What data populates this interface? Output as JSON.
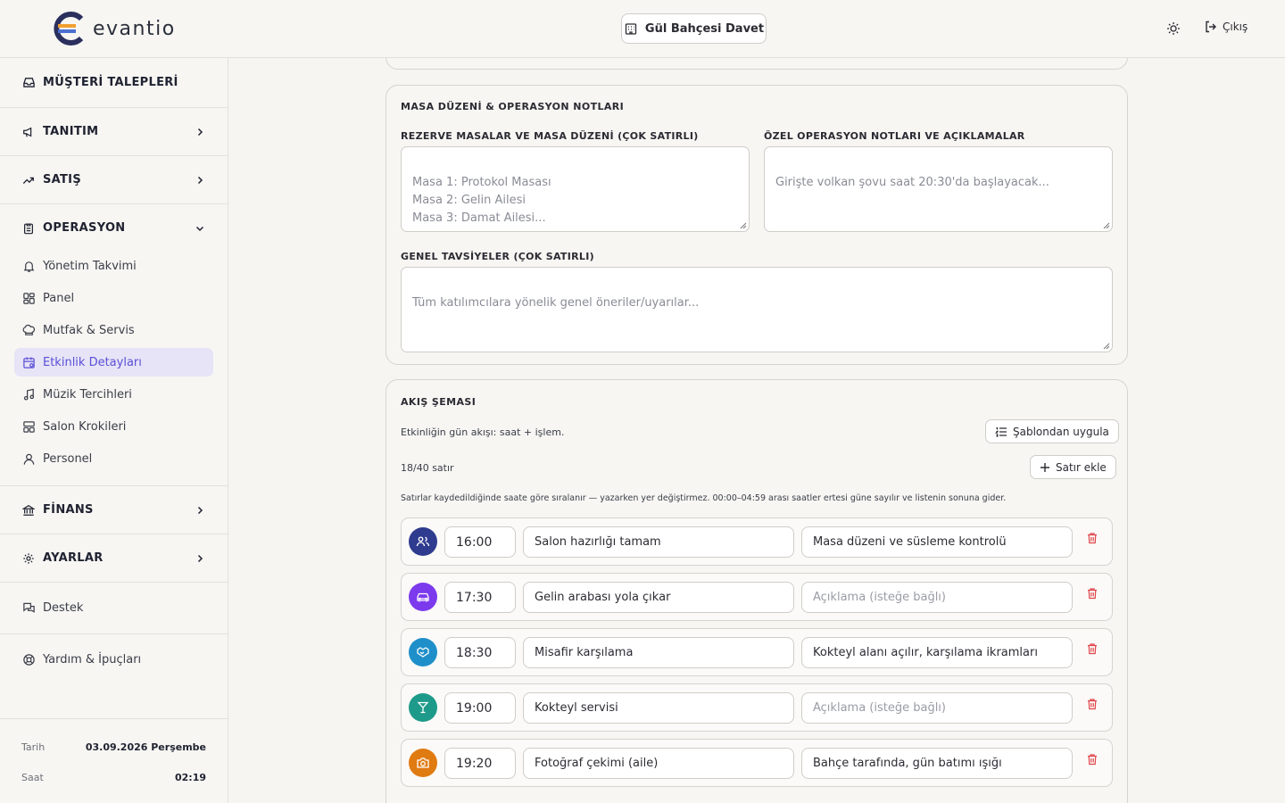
{
  "app": {
    "brand": "evantio"
  },
  "topbar": {
    "event_name": "Gül Bahçesi Davet",
    "logout_label": "Çıkış"
  },
  "sidebar": {
    "customer_requests": "MÜŞTERİ TALEPLERİ",
    "sections": [
      {
        "label": "TANITIM"
      },
      {
        "label": "SATIŞ"
      },
      {
        "label": "OPERASYON"
      },
      {
        "label": "FİNANS"
      },
      {
        "label": "AYARLAR"
      }
    ],
    "operation_items": [
      {
        "label": "Yönetim Takvimi",
        "icon": "bell-icon"
      },
      {
        "label": "Panel",
        "icon": "grid-icon"
      },
      {
        "label": "Mutfak & Servis",
        "icon": "chef-hat-icon"
      },
      {
        "label": "Etkinlik Detayları",
        "icon": "calendar-icon",
        "active": true
      },
      {
        "label": "Müzik Tercihleri",
        "icon": "music-icon"
      },
      {
        "label": "Salon Krokileri",
        "icon": "layout-icon"
      },
      {
        "label": "Personel",
        "icon": "user-icon"
      }
    ],
    "support": "Destek",
    "help": "Yardım & İpuçları",
    "footer": {
      "date_label": "Tarih",
      "date_value": "03.09.2026 Perşembe",
      "time_label": "Saat",
      "time_value": "02:19"
    }
  },
  "notes_card": {
    "title": "MASA DÜZENİ & OPERASYON NOTLARI",
    "reserved_label": "REZERVE MASALAR VE MASA DÜZENİ (ÇOK SATIRLI)",
    "reserved_placeholder": "Masa 1: Protokol Masası\nMasa 2: Gelin Ailesi\nMasa 3: Damat Ailesi...",
    "ops_label": "ÖZEL OPERASYON NOTLARI VE AÇIKLAMALAR",
    "ops_placeholder": "Girişte volkan şovu saat 20:30'da başlayacak...",
    "general_label": "GENEL TAVSİYELER (ÇOK SATIRLI)",
    "general_placeholder": "Tüm katılımcılara yönelik genel öneriler/uyarılar..."
  },
  "flow_card": {
    "title": "AKIŞ ŞEMASI",
    "subtitle": "Etkinliğin gün akışı: saat + işlem.",
    "template_button": "Şablondan uygula",
    "row_count": "18/40 satır",
    "add_row_button": "Satır ekle",
    "hint": "Satırlar kaydedildiğinde saate göre sıralanır — yazarken yer değiştirmez. 00:00–04:59 arası saatler ertesi güne sayılır ve listenin sonuna gider.",
    "rows": [
      {
        "time": "16:00",
        "title": "Salon hazırlığı tamam",
        "desc": "Masa düzeni ve süsleme kontrolü",
        "placeholder": false,
        "icon": "users-icon",
        "color": "#2f3b8f"
      },
      {
        "time": "17:30",
        "title": "Gelin arabası yola çıkar",
        "desc": "Açıklama (isteğe bağlı)",
        "placeholder": true,
        "icon": "car-icon",
        "color": "#7c3aed"
      },
      {
        "time": "18:30",
        "title": "Misafir karşılama",
        "desc": "Kokteyl alanı açılır, karşılama ikramları",
        "placeholder": false,
        "icon": "handshake-icon",
        "color": "#1f8fc9"
      },
      {
        "time": "19:00",
        "title": "Kokteyl servisi",
        "desc": "Açıklama (isteğe bağlı)",
        "placeholder": true,
        "icon": "cocktail-icon",
        "color": "#1e9a8a"
      },
      {
        "time": "19:20",
        "title": "Fotoğraf çekimi (aile)",
        "desc": "Bahçe tarafında, gün batımı ışığı",
        "placeholder": false,
        "icon": "camera-icon",
        "color": "#e07b12"
      }
    ]
  }
}
